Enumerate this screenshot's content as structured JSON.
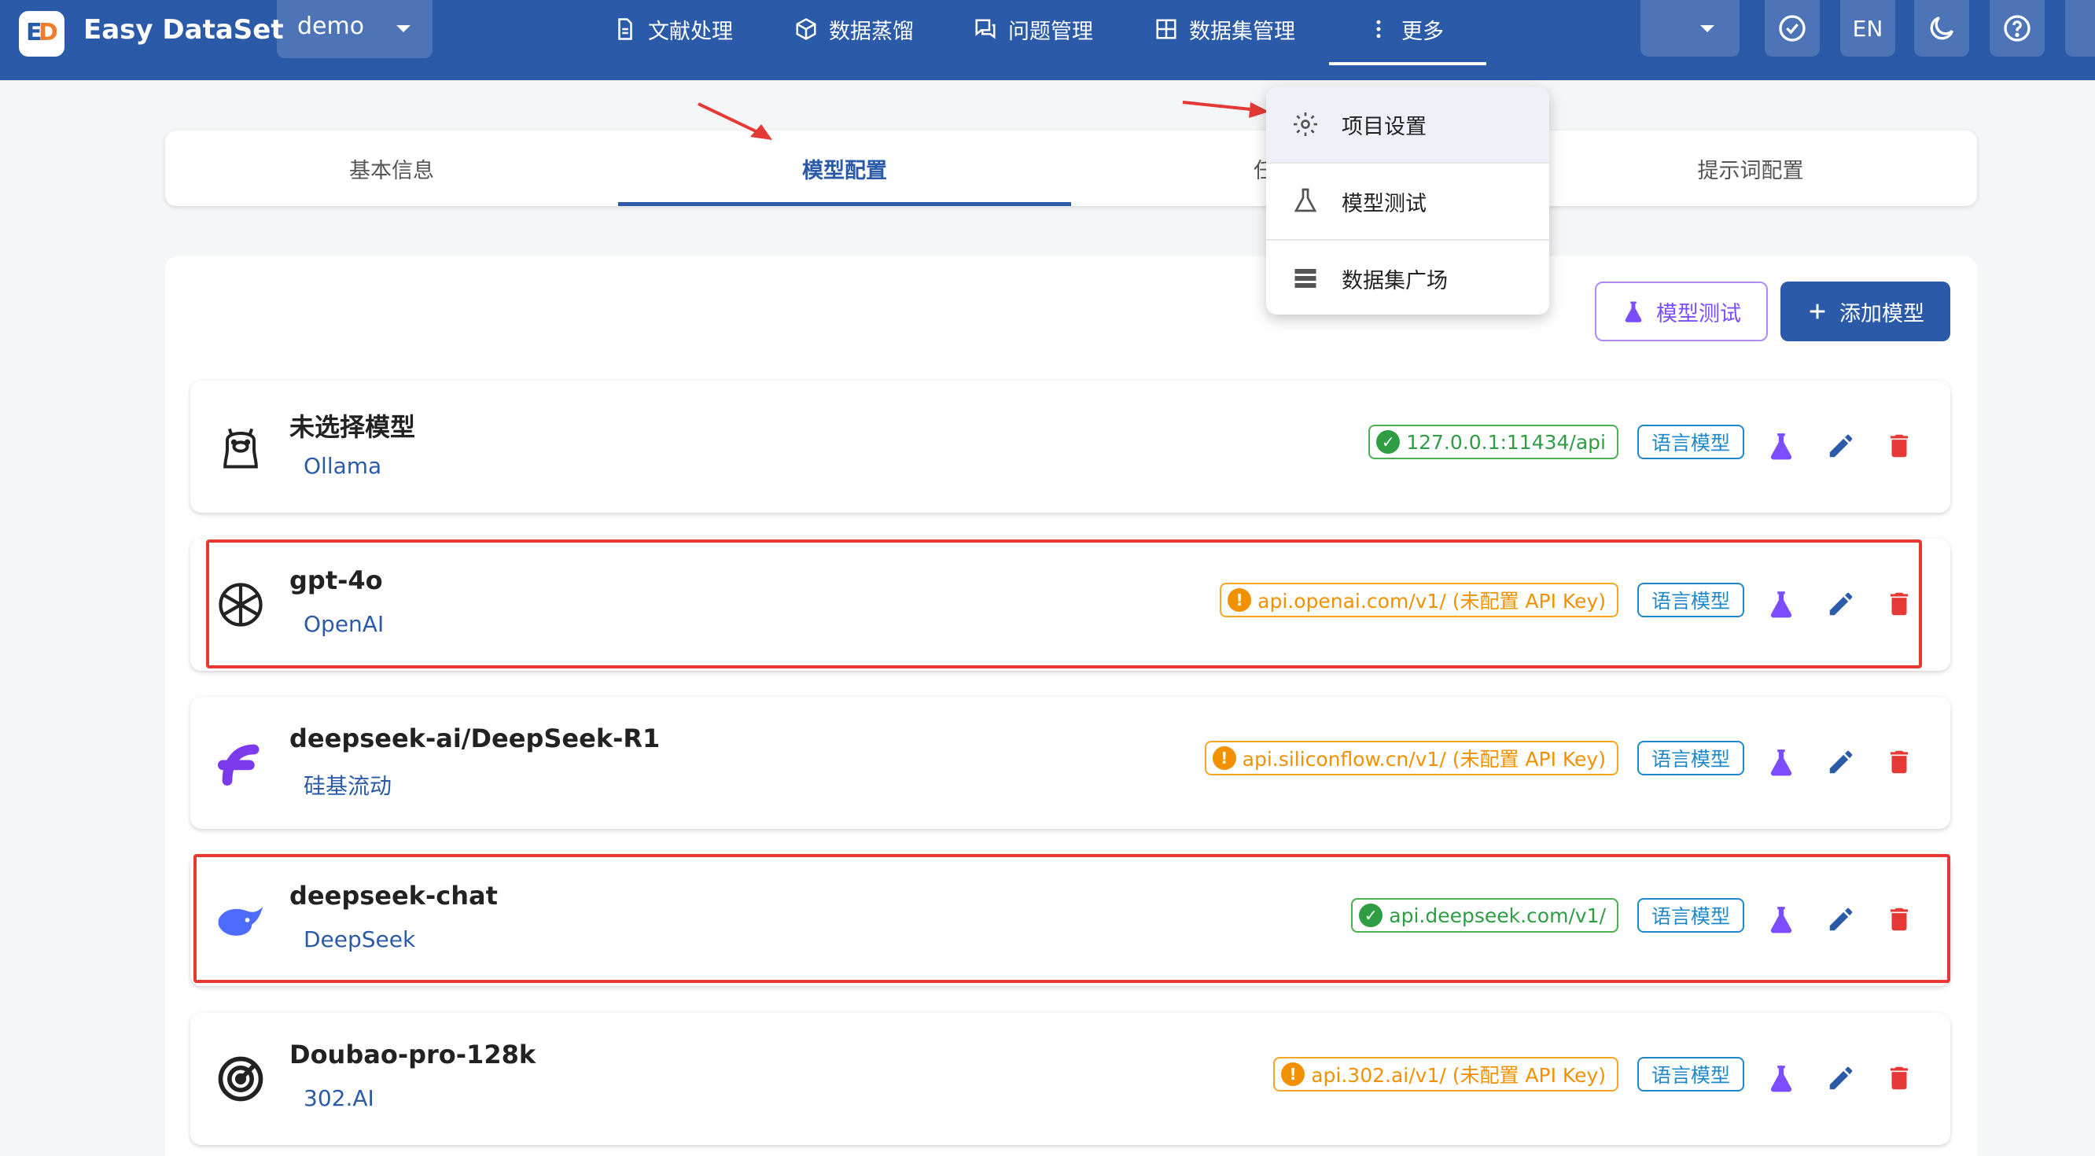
{
  "app": {
    "logo_text": "ED",
    "name": "Easy DataSet"
  },
  "project_select": {
    "value": "demo"
  },
  "nav": [
    {
      "label": "文献处理",
      "icon": "document-icon"
    },
    {
      "label": "数据蒸馏",
      "icon": "cube-icon"
    },
    {
      "label": "问题管理",
      "icon": "chat-icon"
    },
    {
      "label": "数据集管理",
      "icon": "grid-icon"
    },
    {
      "label": "更多",
      "icon": "more-vert-icon"
    }
  ],
  "toolbar": {
    "lang": "EN"
  },
  "tabs": [
    "基本信息",
    "模型配置",
    "任",
    "提示词配置"
  ],
  "actions": {
    "test_label": "模型测试",
    "add_label": "添加模型"
  },
  "menu": [
    {
      "label": "项目设置",
      "icon": "gear-icon"
    },
    {
      "label": "模型测试",
      "icon": "flask-icon"
    },
    {
      "label": "数据集广场",
      "icon": "list-icon"
    }
  ],
  "models": [
    {
      "name": "未选择模型",
      "provider": "Ollama",
      "endpoint": "127.0.0.1:11434/api",
      "status": "ok",
      "type": "语言模型",
      "icon": "ollama-llama-icon"
    },
    {
      "name": "gpt-4o",
      "provider": "OpenAI",
      "endpoint": "api.openai.com/v1/ (未配置 API Key)",
      "status": "warn",
      "type": "语言模型",
      "icon": "openai-logo-icon"
    },
    {
      "name": "deepseek-ai/DeepSeek-R1",
      "provider": "硅基流动",
      "endpoint": "api.siliconflow.cn/v1/ (未配置 API Key)",
      "status": "warn",
      "type": "语言模型",
      "icon": "siliconflow-logo-icon"
    },
    {
      "name": "deepseek-chat",
      "provider": "DeepSeek",
      "endpoint": "api.deepseek.com/v1/",
      "status": "ok",
      "type": "语言模型",
      "icon": "deepseek-whale-icon"
    },
    {
      "name": "Doubao-pro-128k",
      "provider": "302.AI",
      "endpoint": "api.302.ai/v1/ (未配置 API Key)",
      "status": "warn",
      "type": "语言模型",
      "icon": "302ai-logo-icon"
    }
  ],
  "colors": {
    "primary": "#2b5aa8",
    "success": "#2e9d44",
    "warning": "#f29100",
    "info": "#1e88c8",
    "accent": "#7c4dff",
    "danger": "#e53935"
  }
}
